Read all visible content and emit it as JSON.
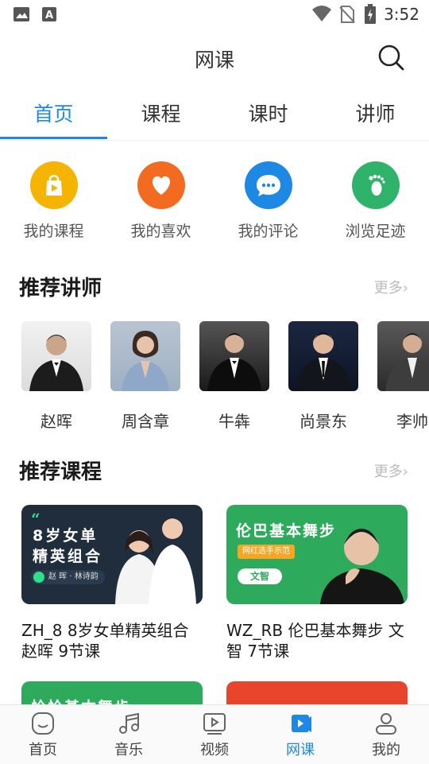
{
  "status": {
    "time": "3:52"
  },
  "header": {
    "title": "网课"
  },
  "tabs": [
    {
      "label": "首页",
      "active": true
    },
    {
      "label": "课程",
      "active": false
    },
    {
      "label": "课时",
      "active": false
    },
    {
      "label": "讲师",
      "active": false
    }
  ],
  "quick": [
    {
      "label": "我的课程",
      "color": "#f5b400",
      "icon": "bag-icon"
    },
    {
      "label": "我的喜欢",
      "color": "#f36b21",
      "icon": "heart-icon"
    },
    {
      "label": "我的评论",
      "color": "#1e88e5",
      "icon": "comment-icon"
    },
    {
      "label": "浏览足迹",
      "color": "#2fb36a",
      "icon": "footprint-icon"
    }
  ],
  "teachers_section": {
    "title": "推荐讲师",
    "more": "更多›"
  },
  "teachers": [
    {
      "name": "赵晖"
    },
    {
      "name": "周含章"
    },
    {
      "name": "牛犇"
    },
    {
      "name": "尚景东"
    },
    {
      "name": "李帅"
    }
  ],
  "courses_section": {
    "title": "推荐课程",
    "more": "更多›"
  },
  "courses": [
    {
      "title": "ZH_8 8岁女单精英组合 赵晖 9节课",
      "banner_line1": "8岁女单",
      "banner_line2": "精英组合",
      "banner_names": "赵 晖 · 林诗韵",
      "bg": "#1f2d3d"
    },
    {
      "title": "WZ_RB 伦巴基本舞步 文智 7节课",
      "banner_line1": "伦巴基本舞步",
      "banner_tag": "网红选手示范",
      "banner_name": "文智",
      "bg": "#2eaa5c"
    }
  ],
  "partial_courses": [
    {
      "banner_line1": "恰恰基本舞步",
      "bg": "#2eaa5c"
    },
    {
      "bg": "#e8452c"
    }
  ],
  "bottom_nav": [
    {
      "label": "首页",
      "icon": "home-icon",
      "active": false
    },
    {
      "label": "音乐",
      "icon": "music-icon",
      "active": false
    },
    {
      "label": "视频",
      "icon": "video-icon",
      "active": false
    },
    {
      "label": "网课",
      "icon": "course-icon",
      "active": true
    },
    {
      "label": "我的",
      "icon": "profile-icon",
      "active": false
    }
  ]
}
